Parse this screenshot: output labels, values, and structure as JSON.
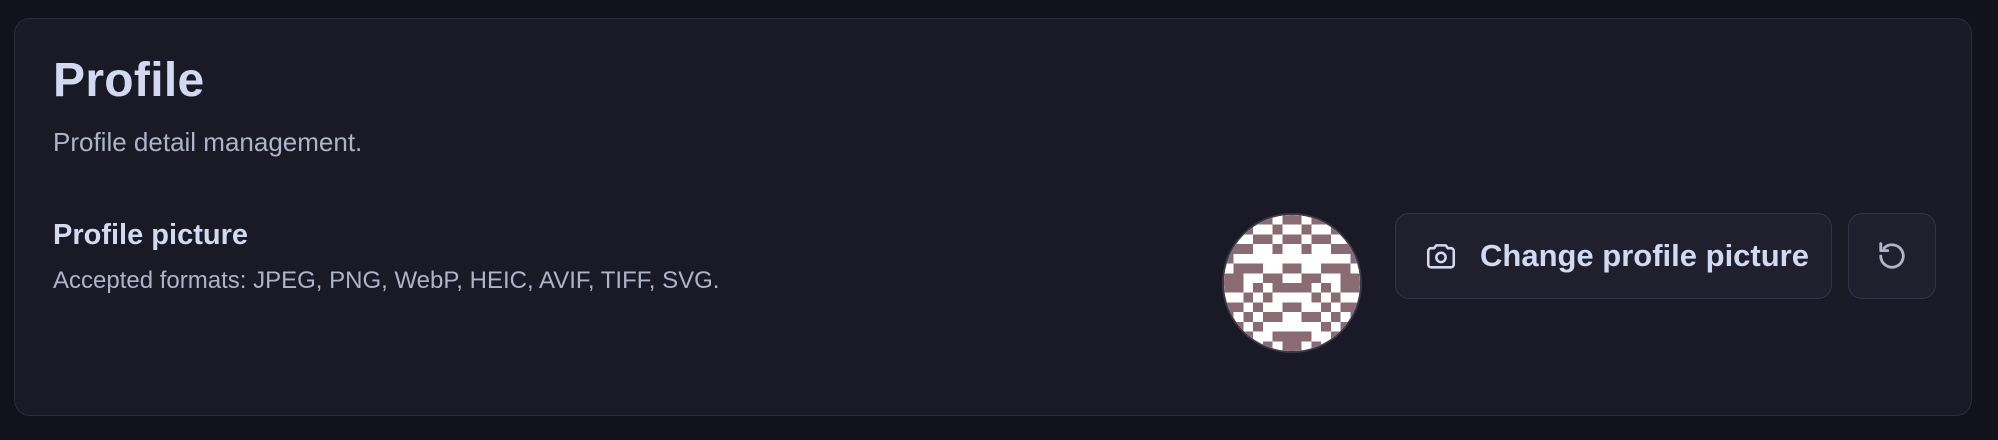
{
  "profile": {
    "title": "Profile",
    "subtitle": "Profile detail management.",
    "picture": {
      "label": "Profile picture",
      "hint": "Accepted formats: JPEG, PNG, WebP, HEIC, AVIF, TIFF, SVG.",
      "avatar_colors": {
        "fg": "#8a6b73",
        "bg": "#ffffff"
      },
      "change_button_label": "Change profile picture",
      "change_button_icon": "camera-icon",
      "reset_button_icon": "reset-icon"
    }
  },
  "colors": {
    "page_bg": "#12121c",
    "card_bg": "#1a1a26",
    "text_primary": "#d4d9f2",
    "text_secondary": "#aeb3c9"
  }
}
